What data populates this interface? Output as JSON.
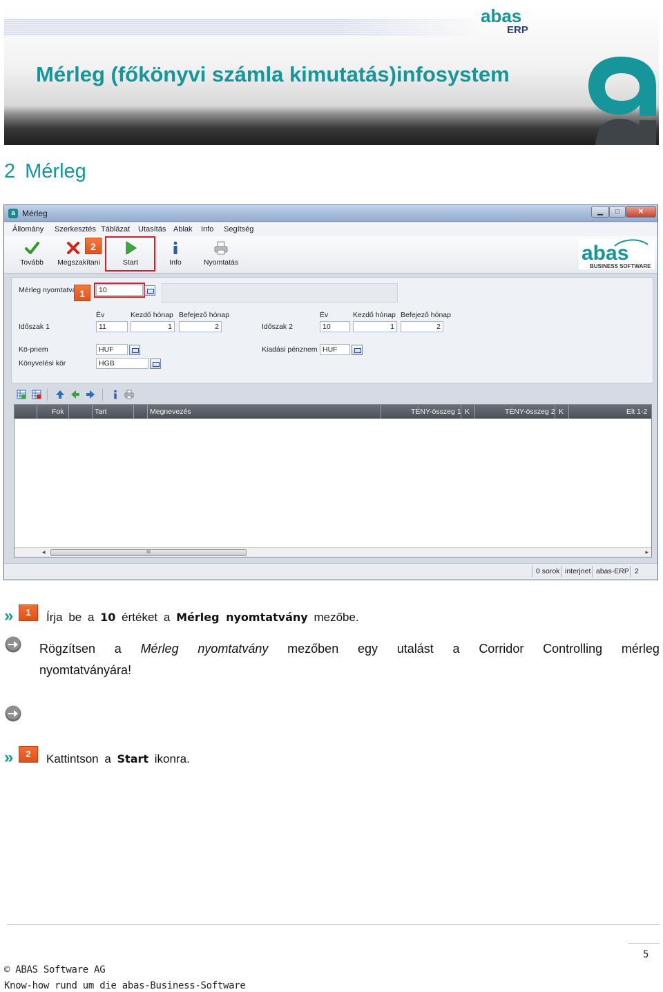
{
  "banner": {
    "logo_text_top": "abas",
    "logo_text_bottom": "ERP",
    "title": "Mérleg (főkönyvi számla kimutatás)infosystem",
    "brand_color": "#16969a"
  },
  "section": {
    "number": "2",
    "title": "Mérleg"
  },
  "window": {
    "title": "Mérleg",
    "menu": [
      "Állomány",
      "Szerkesztés",
      "Táblázat",
      "Utasítás",
      "Ablak",
      "Info",
      "Segítség"
    ],
    "toolbar": {
      "tovabb": "Tovább",
      "megszakitani": "Megszakítani",
      "start": "Start",
      "info": "Info",
      "nyomtatas": "Nyomtatás"
    },
    "logo": {
      "name": "abas",
      "tagline": "BUSINESS SOFTWARE"
    },
    "form": {
      "merleg_label": "Mérleg nyomtatvá",
      "merleg_value": "10",
      "ev_label": "Év",
      "kezdo_label": "Kezdő hónap",
      "befejezo_label": "Befejező hónap",
      "idoszak1_label": "Időszak 1",
      "idoszak1_ev": "11",
      "idoszak1_kezdo": "1",
      "idoszak1_befejezo": "2",
      "idoszak2_label": "Időszak 2",
      "idoszak2_ev": "10",
      "idoszak2_kezdo": "1",
      "idoszak2_befejezo": "2",
      "kopnem_label": "Kö-pnem",
      "kopnem_value": "HUF",
      "kiadasi_label": "Kiadási pénznem",
      "kiadasi_value": "HUF",
      "konyvelesi_label": "Könyvelési kör",
      "konyvelesi_value": "HGB"
    },
    "grid_columns": [
      "Fok",
      "Tart",
      "Megnevezés",
      "TÉNY-összeg 1",
      "K",
      "TÉNY-összeg 2",
      "K",
      "Elt 1-2"
    ],
    "scroll_thumb": "III",
    "status": [
      "0 sorok",
      "interjnet",
      "abas-ERP",
      "2"
    ]
  },
  "markers": {
    "one": "1",
    "two": "2"
  },
  "instructions": {
    "step1": {
      "pre": "Írja be a",
      "value": "10",
      "mid": "értéket a",
      "field": "Mérleg nyomtatvány",
      "post": "mezőbe."
    },
    "note_words": [
      "Rögzítsen",
      "a",
      "Mérleg",
      "nyomtatvány",
      "mezőben",
      "egy",
      "utalást",
      "a",
      "Corridor",
      "Controlling",
      "mérleg"
    ],
    "note_line2": "nyomtatványára!",
    "step2": {
      "pre": "Kattintson a",
      "button": "Start",
      "post": "ikonra."
    }
  },
  "footer": {
    "page": "5",
    "copyright": "© ABAS Software AG",
    "tagline": "Know-how rund um die abas-Business-Software"
  }
}
